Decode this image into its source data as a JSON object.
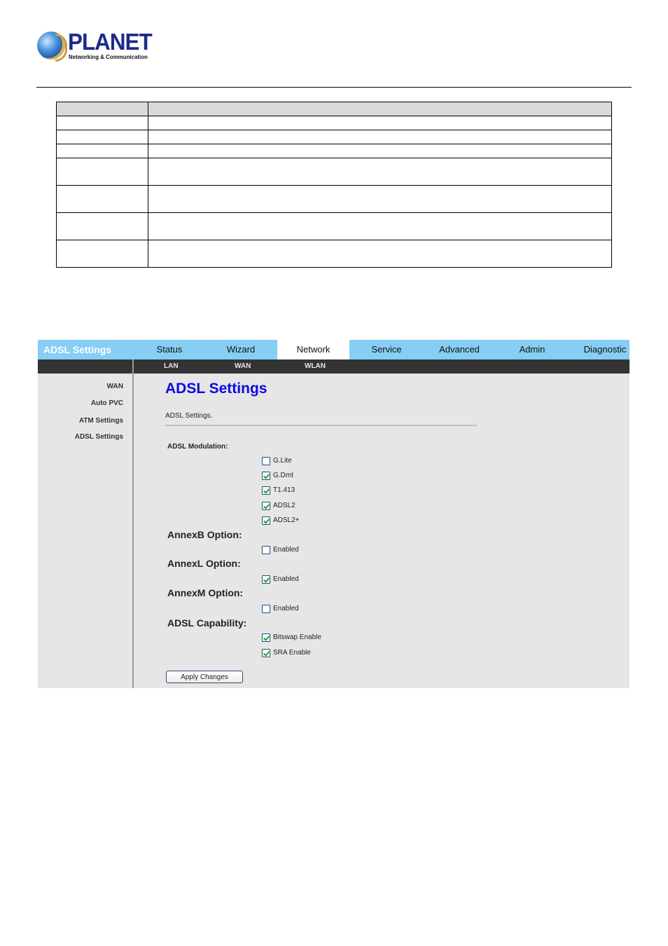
{
  "document": {
    "logo": {
      "wordmark": "PLANET",
      "tagline": "Networking & Communication"
    },
    "table": {
      "header": [
        "",
        ""
      ],
      "rows": [
        [
          "",
          ""
        ],
        [
          "",
          ""
        ],
        [
          "",
          ""
        ],
        [
          "",
          ""
        ],
        [
          "",
          ""
        ],
        [
          "",
          ""
        ],
        [
          "",
          ""
        ]
      ]
    }
  },
  "router_ui": {
    "brand_title": "ADSL Settings",
    "top_tabs": [
      {
        "label": "Status",
        "active": false
      },
      {
        "label": "Wizard",
        "active": false
      },
      {
        "label": "Network",
        "active": true
      },
      {
        "label": "Service",
        "active": false
      },
      {
        "label": "Advanced",
        "active": false
      },
      {
        "label": "Admin",
        "active": false
      },
      {
        "label": "Diagnostic",
        "active": false
      }
    ],
    "sub_tabs": [
      "LAN",
      "WAN",
      "WLAN"
    ],
    "sidebar": [
      "WAN",
      "Auto PVC",
      "ATM Settings",
      "ADSL Settings"
    ],
    "page_title": "ADSL Settings",
    "page_description": "ADSL Settings.",
    "modulation": {
      "label": "ADSL Modulation:",
      "options": [
        {
          "label": "G.Lite",
          "checked": false
        },
        {
          "label": "G.Dmt",
          "checked": true
        },
        {
          "label": "T1.413",
          "checked": true
        },
        {
          "label": "ADSL2",
          "checked": true
        },
        {
          "label": "ADSL2+",
          "checked": true
        }
      ]
    },
    "annexb": {
      "label": "AnnexB Option:",
      "option": {
        "label": "Enabled",
        "checked": false
      }
    },
    "annexl": {
      "label": "AnnexL Option:",
      "option": {
        "label": "Enabled",
        "checked": true
      }
    },
    "annexm": {
      "label": "AnnexM Option:",
      "option": {
        "label": "Enabled",
        "checked": false
      }
    },
    "capability": {
      "label": "ADSL Capability:",
      "options": [
        {
          "label": "Bitswap Enable",
          "checked": true
        },
        {
          "label": "SRA Enable",
          "checked": true
        }
      ]
    },
    "apply_button": "Apply Changes",
    "colors": {
      "nav_bg": "#87cef5",
      "subnav_bg": "#333333",
      "content_bg": "#e6e6e6",
      "title_blue": "#0a0ae6",
      "check_green": "#22a31f"
    }
  }
}
